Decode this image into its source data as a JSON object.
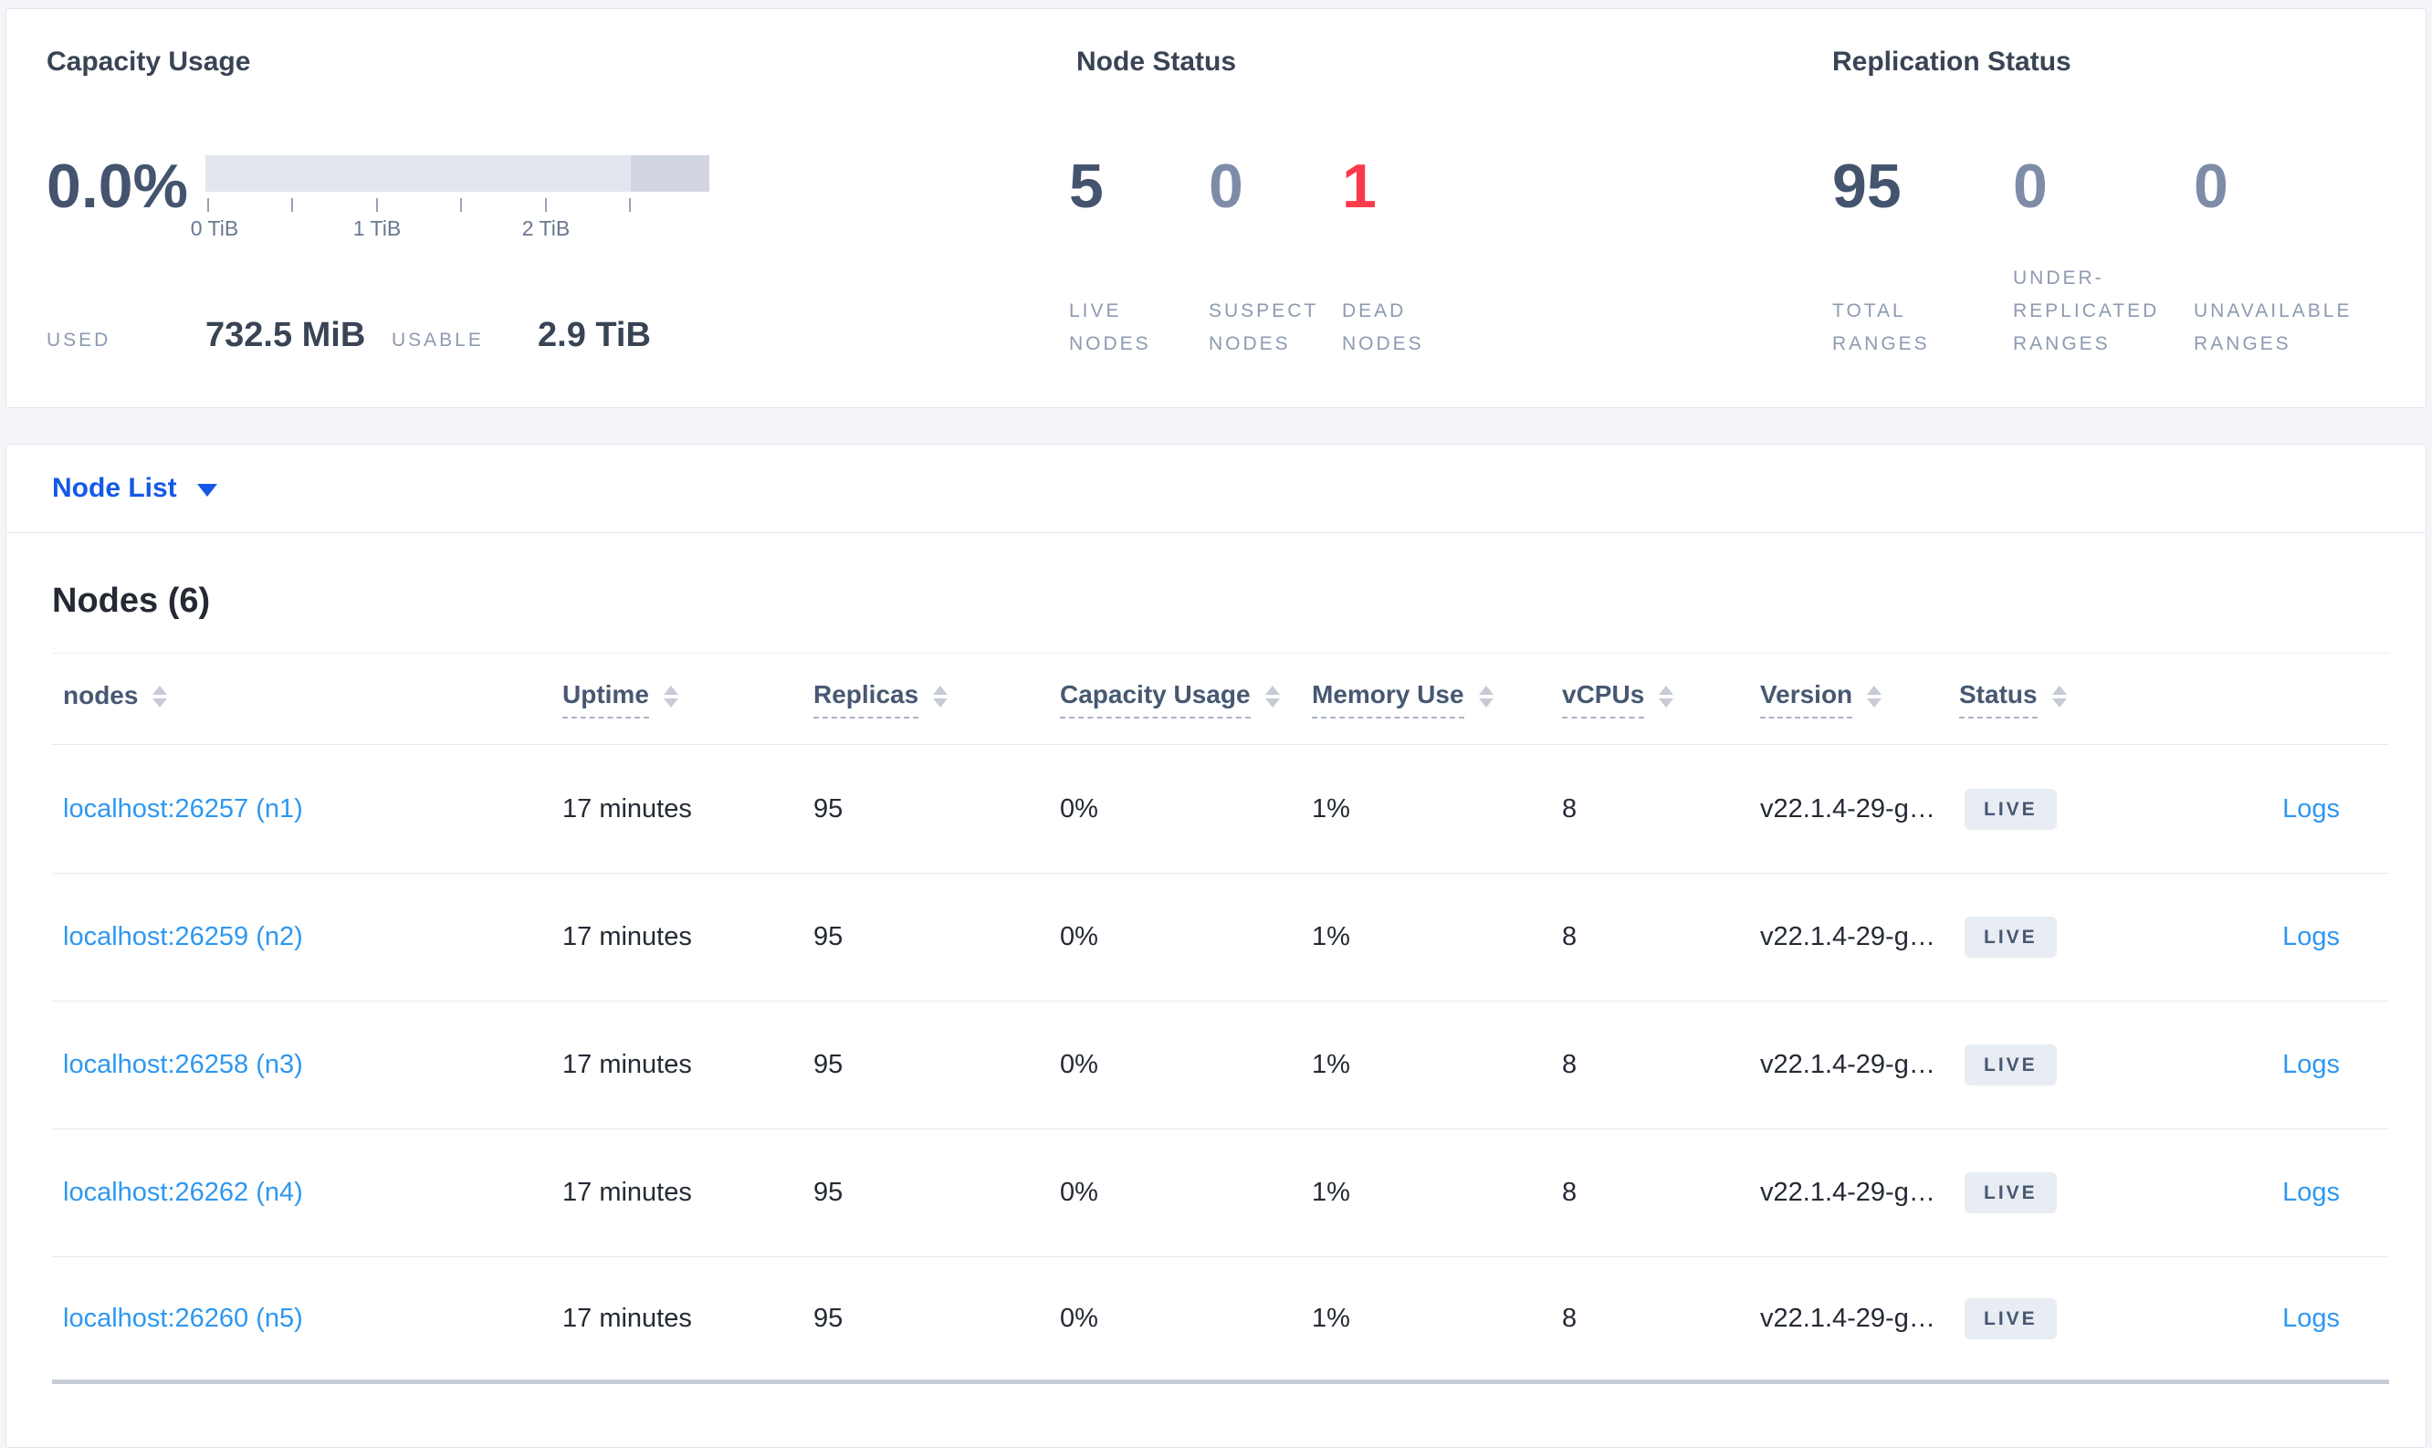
{
  "colors": {
    "accent_blue": "#1458e6",
    "link_blue": "#2e97f0",
    "dead_red": "#fb3b4d",
    "muted_num": "#7f8ca8",
    "dark_num": "#44546e",
    "badge_bg": "#e8ecf3"
  },
  "capacity": {
    "title": "Capacity Usage",
    "percent": "0.0%",
    "used_label": "USED",
    "used_value": "732.5 MiB",
    "usable_label": "USABLE",
    "usable_value": "2.9 TiB",
    "axis_ticks": [
      "0 TiB",
      "1 TiB",
      "2 TiB"
    ]
  },
  "node_status": {
    "title": "Node Status",
    "stats": [
      {
        "value": "5",
        "tone": "dark",
        "label_lines": [
          "LIVE",
          "NODES"
        ]
      },
      {
        "value": "0",
        "tone": "muted",
        "label_lines": [
          "SUSPECT",
          "NODES"
        ]
      },
      {
        "value": "1",
        "tone": "red",
        "label_lines": [
          "DEAD",
          "NODES"
        ]
      }
    ]
  },
  "replication": {
    "title": "Replication Status",
    "stats": [
      {
        "value": "95",
        "tone": "dark",
        "label_lines": [
          "TOTAL",
          "RANGES"
        ]
      },
      {
        "value": "0",
        "tone": "muted",
        "label_lines": [
          "UNDER-",
          "REPLICATED",
          "RANGES"
        ]
      },
      {
        "value": "0",
        "tone": "muted",
        "label_lines": [
          "UNAVAILABLE",
          "RANGES"
        ]
      }
    ]
  },
  "node_list": {
    "label": "Node List"
  },
  "nodes_table": {
    "heading": "Nodes (6)",
    "columns": [
      {
        "label": "nodes",
        "underline": false
      },
      {
        "label": "Uptime",
        "underline": true
      },
      {
        "label": "Replicas",
        "underline": true
      },
      {
        "label": "Capacity Usage",
        "underline": true
      },
      {
        "label": "Memory Use",
        "underline": true
      },
      {
        "label": "vCPUs",
        "underline": true
      },
      {
        "label": "Version",
        "underline": true
      },
      {
        "label": "Status",
        "underline": true
      }
    ],
    "logs_label": "Logs",
    "rows": [
      {
        "address": "localhost:26257 (n1)",
        "uptime": "17 minutes",
        "replicas": "95",
        "capacity": "0%",
        "memory": "1%",
        "vcpus": "8",
        "version": "v22.1.4-29-g…",
        "status": "LIVE"
      },
      {
        "address": "localhost:26259 (n2)",
        "uptime": "17 minutes",
        "replicas": "95",
        "capacity": "0%",
        "memory": "1%",
        "vcpus": "8",
        "version": "v22.1.4-29-g…",
        "status": "LIVE"
      },
      {
        "address": "localhost:26258 (n3)",
        "uptime": "17 minutes",
        "replicas": "95",
        "capacity": "0%",
        "memory": "1%",
        "vcpus": "8",
        "version": "v22.1.4-29-g…",
        "status": "LIVE"
      },
      {
        "address": "localhost:26262 (n4)",
        "uptime": "17 minutes",
        "replicas": "95",
        "capacity": "0%",
        "memory": "1%",
        "vcpus": "8",
        "version": "v22.1.4-29-g…",
        "status": "LIVE"
      },
      {
        "address": "localhost:26260 (n5)",
        "uptime": "17 minutes",
        "replicas": "95",
        "capacity": "0%",
        "memory": "1%",
        "vcpus": "8",
        "version": "v22.1.4-29-g…",
        "status": "LIVE"
      }
    ]
  }
}
